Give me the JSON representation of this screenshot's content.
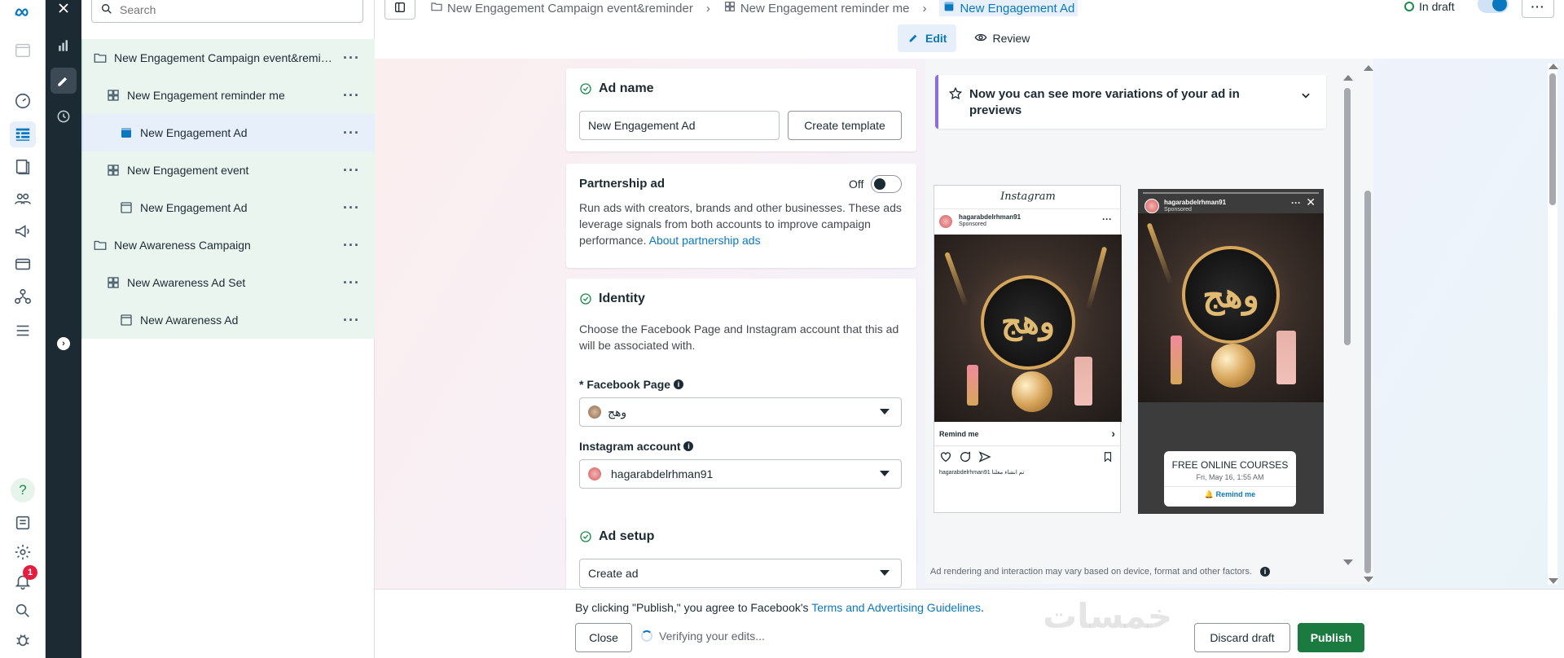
{
  "rail": {
    "notifications_count": "1"
  },
  "tree": {
    "search_placeholder": "Search",
    "items": [
      {
        "label": "New Engagement Campaign event&reminder",
        "icon": "folder-icon",
        "level": 0
      },
      {
        "label": "New Engagement reminder me",
        "icon": "adset-grid-icon",
        "level": 1
      },
      {
        "label": "New Engagement Ad",
        "icon": "ad-icon",
        "level": 2,
        "selected": true
      },
      {
        "label": "New Engagement event",
        "icon": "adset-grid-icon",
        "level": 1
      },
      {
        "label": "New Engagement Ad",
        "icon": "ad-icon",
        "level": 2
      },
      {
        "label": "New Awareness Campaign",
        "icon": "folder-icon",
        "level": 0
      },
      {
        "label": "New Awareness Ad Set",
        "icon": "adset-grid-icon",
        "level": 1
      },
      {
        "label": "New Awareness Ad",
        "icon": "ad-icon",
        "level": 2
      }
    ]
  },
  "topbar": {
    "breadcrumbs": [
      "New Engagement Campaign event&reminder",
      "New Engagement reminder me",
      "New Engagement Ad"
    ],
    "status": "In draft",
    "tabs": [
      "Edit",
      "Review"
    ]
  },
  "ad_name": {
    "title": "Ad name",
    "value": "New Engagement Ad",
    "template_button": "Create template"
  },
  "partnership": {
    "title": "Partnership ad",
    "toggle_label": "Off",
    "description": "Run ads with creators, brands and other businesses. These ads leverage signals from both accounts to improve campaign performance.",
    "link": "About partnership ads"
  },
  "identity": {
    "title": "Identity",
    "description": "Choose the Facebook Page and Instagram account that this ad will be associated with.",
    "page_label": "* Facebook Page",
    "page_value": "وهج",
    "instagram_label": "Instagram account",
    "instagram_value": "hagarabdelrhman91"
  },
  "ad_setup": {
    "title": "Ad setup",
    "value": "Create ad"
  },
  "preview": {
    "banner": "Now you can see more variations of your ad in previews",
    "feed": {
      "platform": "Instagram",
      "account": "hagarabdelrhman91",
      "sponsored": "Sponsored",
      "cta": "Remind me",
      "caption": "hagarabdelrhman91 تم انشاء معلنا"
    },
    "story": {
      "account": "hagarabdelrhman91",
      "sponsored": "Sponsored",
      "event_title": "FREE ONLINE COURSES",
      "event_date": "Fri, May 16, 1:55 AM",
      "cta": "Remind me"
    },
    "disclaimer": "Ad rendering and interaction may vary based on device, format and other factors."
  },
  "footer": {
    "terms_prefix": "By clicking \"Publish,\" you agree to Facebook's",
    "terms_link": "Terms and Advertising Guidelines",
    "terms_suffix": ".",
    "close": "Close",
    "verifying": "Verifying your edits...",
    "watermark": "خمسات",
    "discard": "Discard draft",
    "publish": "Publish"
  },
  "colors": {
    "accent": "#0a78be",
    "publish": "#1a7a3f",
    "rail_dark": "#1c2b33",
    "tree_green": "#ebf5f0"
  }
}
